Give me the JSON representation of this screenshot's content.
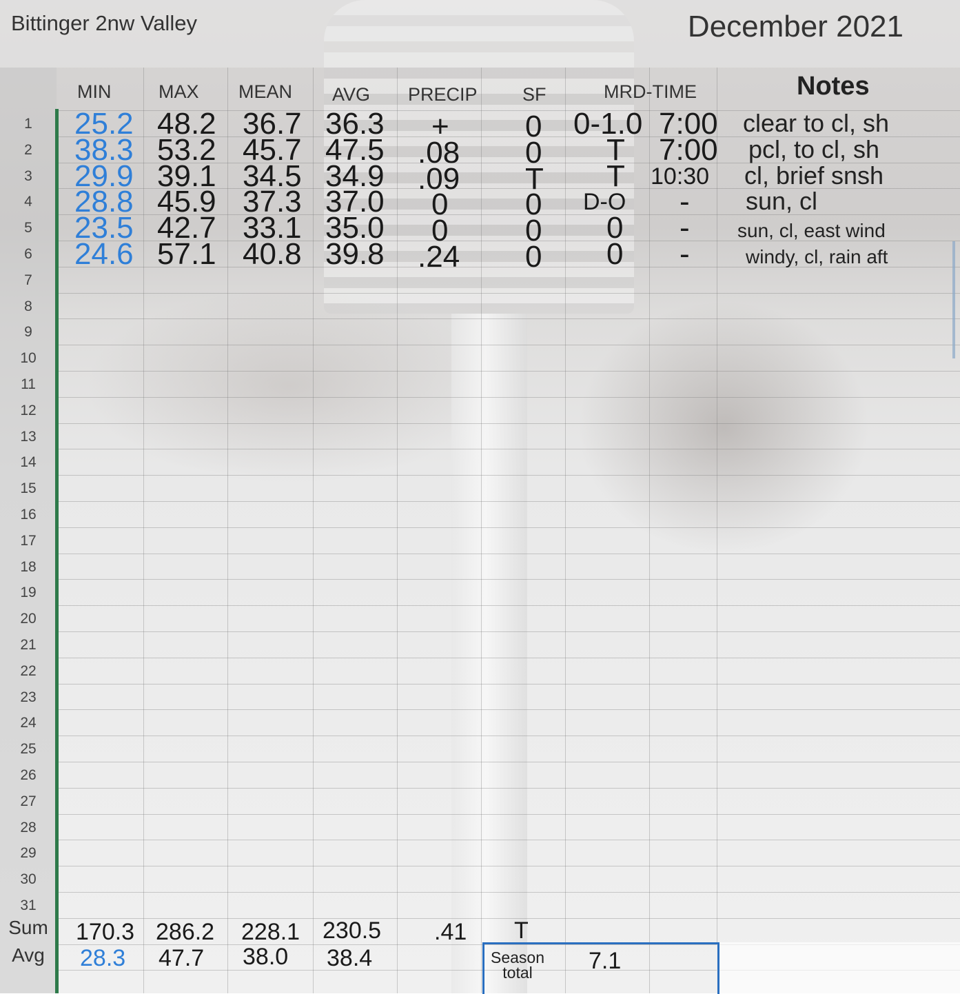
{
  "header": {
    "station": "Bittinger 2nw Valley",
    "month": "December 2021"
  },
  "columns": [
    "MIN",
    "MAX",
    "MEAN",
    "AVG",
    "PRECIP",
    "SF",
    "MRD-TIME",
    "Notes"
  ],
  "row_numbers": [
    "1",
    "2",
    "3",
    "4",
    "5",
    "6",
    "7",
    "8",
    "9",
    "10",
    "11",
    "12",
    "13",
    "14",
    "15",
    "16",
    "17",
    "18",
    "19",
    "20",
    "21",
    "22",
    "23",
    "24",
    "25",
    "26",
    "27",
    "28",
    "29",
    "30",
    "31"
  ],
  "rows": [
    {
      "min": "25.2",
      "max": "48.2",
      "mean": "36.7",
      "avg": "36.3",
      "precip": "+",
      "sf": "0",
      "mrd": "0-1.0",
      "time": "7:00",
      "note": "clear to cl, sh"
    },
    {
      "min": "38.3",
      "max": "53.2",
      "mean": "45.7",
      "avg": "47.5",
      "precip": ".08",
      "sf": "0",
      "mrd": "T",
      "time": "7:00",
      "note": "pcl, to cl, sh"
    },
    {
      "min": "29.9",
      "max": "39.1",
      "mean": "34.5",
      "avg": "34.9",
      "precip": ".09",
      "sf": "T",
      "mrd": "T",
      "time": "10:30",
      "note": "cl,  brief snsh"
    },
    {
      "min": "28.8",
      "max": "45.9",
      "mean": "37.3",
      "avg": "37.0",
      "precip": "0",
      "sf": "0",
      "mrd": "D-O",
      "time": "-",
      "note": "sun, cl"
    },
    {
      "min": "23.5",
      "max": "42.7",
      "mean": "33.1",
      "avg": "35.0",
      "precip": "0",
      "sf": "0",
      "mrd": "0",
      "time": "-",
      "note": "sun, cl, east wind"
    },
    {
      "min": "24.6",
      "max": "57.1",
      "mean": "40.8",
      "avg": "39.8",
      "precip": ".24",
      "sf": "0",
      "mrd": "0",
      "time": "-",
      "note": "windy, cl, rain aft"
    }
  ],
  "sum": {
    "label": "Sum",
    "min": "170.3",
    "max": "286.2",
    "mean": "228.1",
    "avg": "230.5",
    "precip": ".41",
    "sf": "T"
  },
  "avg": {
    "label": "Avg",
    "min": "28.3",
    "max": "47.7",
    "mean": "38.0",
    "avg": "38.4"
  },
  "season": {
    "label_line1": "Season",
    "label_line2": "total",
    "value": "7.1"
  },
  "colors": {
    "min_text": "#2f7fd8",
    "gridline_accent": "#2e7a4a",
    "selection": "#2a6fc0"
  }
}
